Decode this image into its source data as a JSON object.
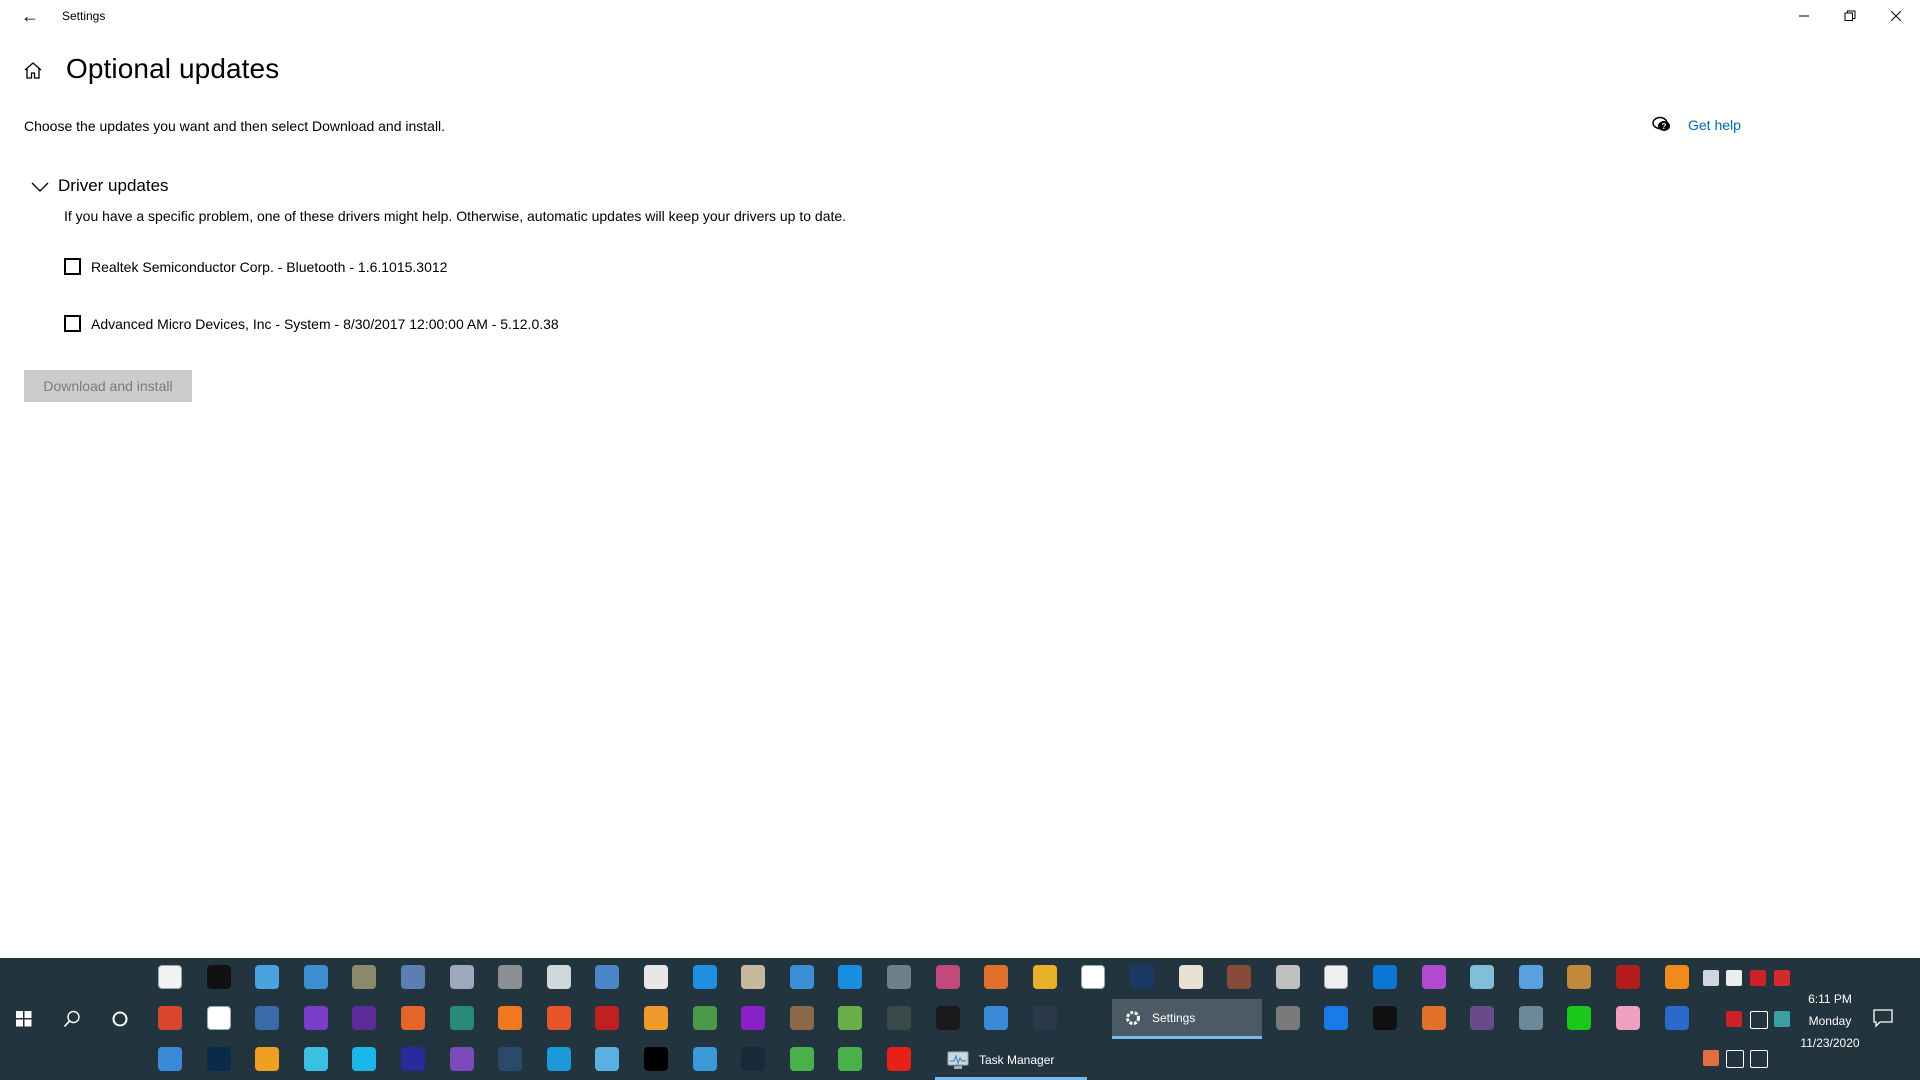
{
  "window": {
    "title": "Settings",
    "back_icon": "back-arrow-icon",
    "controls": {
      "minimize": "minimize-icon",
      "maximize": "restore-icon",
      "close": "close-icon"
    }
  },
  "header": {
    "home_icon": "home-icon",
    "title": "Optional updates",
    "intro": "Choose the updates you want and then select Download and install.",
    "help_label": "Get help",
    "help_icon": "chat-help-icon"
  },
  "section": {
    "title": "Driver updates",
    "expanded": true,
    "description": "If you have a specific problem, one of these drivers might help. Otherwise, automatic updates will keep your drivers up to date.",
    "items": [
      {
        "label": "Realtek Semiconductor Corp. - Bluetooth - 1.6.1015.3012",
        "checked": false
      },
      {
        "label": "Advanced Micro Devices, Inc - System - 8/30/2017 12:00:00 AM - 5.12.0.38",
        "checked": false
      }
    ]
  },
  "actions": {
    "download_label": "Download and install",
    "download_enabled": false
  },
  "taskbar": {
    "start_icon": "windows-start-icon",
    "search_icon": "search-icon",
    "cortana_icon": "cortana-icon",
    "running": [
      {
        "label": "Settings",
        "icon": "settings-gear-icon",
        "active": true
      },
      {
        "label": "Task Manager",
        "icon": "task-manager-icon",
        "active": false
      }
    ],
    "pinned_row1": [
      {
        "name": "microsoft-store-icon",
        "color": "#f2f2f2"
      },
      {
        "name": "command-prompt-icon",
        "color": "#111111"
      },
      {
        "name": "control-panel-icon",
        "color": "#4aa3df"
      },
      {
        "name": "remote-desktop-icon",
        "color": "#3d8fd1"
      },
      {
        "name": "xbox-accessories-icon",
        "color": "#8a8a6a"
      },
      {
        "name": "printer-icon",
        "color": "#5a7fb0"
      },
      {
        "name": "registry-icon",
        "color": "#a0a8c0"
      },
      {
        "name": "security-lock-icon",
        "color": "#8a8f95"
      },
      {
        "name": "services-gear-icon",
        "color": "#cfd6dc"
      },
      {
        "name": "system-info-icon",
        "color": "#4a86c8"
      },
      {
        "name": "clock-icon",
        "color": "#e7e7e7"
      },
      {
        "name": "internet-explorer-icon",
        "color": "#1e90e0"
      },
      {
        "name": "paint-icon",
        "color": "#c8b89a"
      },
      {
        "name": "media-player-icon",
        "color": "#3b8fd6"
      },
      {
        "name": "mail-icon",
        "color": "#1a8ee0"
      },
      {
        "name": "calculator-icon",
        "color": "#6f7f8c"
      },
      {
        "name": "groove-music-icon",
        "color": "#c24a7a"
      },
      {
        "name": "temperature-icon",
        "color": "#e0712a"
      },
      {
        "name": "chrome-icon",
        "color": "#e8b12a"
      },
      {
        "name": "people-icon",
        "color": "#ffffff"
      },
      {
        "name": "steam-icon",
        "color": "#1b3a63"
      },
      {
        "name": "compass-icon",
        "color": "#e8e0d0"
      },
      {
        "name": "firewall-icon",
        "color": "#8a4a3a"
      },
      {
        "name": "memory-icon",
        "color": "#c0c0c0"
      },
      {
        "name": "drive-icon",
        "color": "#f0f0f0"
      },
      {
        "name": "settings-blue-icon",
        "color": "#0b78d6"
      },
      {
        "name": "office-tools-icon",
        "color": "#b24ad0"
      },
      {
        "name": "notepad-icon",
        "color": "#7fc0d8"
      },
      {
        "name": "wordpad-icon",
        "color": "#5aa0e0"
      },
      {
        "name": "disc-burn-icon",
        "color": "#c08a3a"
      },
      {
        "name": "acrobat-icon",
        "color": "#b71c1c"
      },
      {
        "name": "vlc-icon",
        "color": "#f08a1a"
      }
    ],
    "pinned_row2": [
      {
        "name": "power-icon",
        "color": "#d9452f"
      },
      {
        "name": "windows-security-icon",
        "color": "#ffffff"
      },
      {
        "name": "windows7-orb-icon",
        "color": "#3a6aa8"
      },
      {
        "name": "twitch-icon",
        "color": "#7b3ccc"
      },
      {
        "name": "cpu-icon",
        "color": "#5b2c9a"
      },
      {
        "name": "origin-icon",
        "color": "#e8652a"
      },
      {
        "name": "mouse-keyboard-icon",
        "color": "#2a8a7a"
      },
      {
        "name": "asterisk-app-icon",
        "color": "#f07820"
      },
      {
        "name": "firefox-icon",
        "color": "#e8552a"
      },
      {
        "name": "flash-icon",
        "color": "#c02020"
      },
      {
        "name": "orange-app-icon",
        "color": "#f09a2a"
      },
      {
        "name": "network-card-icon",
        "color": "#4a9a4a"
      },
      {
        "name": "purple-ring-icon",
        "color": "#8a20c8"
      },
      {
        "name": "game-warrior-icon",
        "color": "#8a6a4a"
      },
      {
        "name": "game-pixel-icon",
        "color": "#6ab04a"
      },
      {
        "name": "shield-swords-icon",
        "color": "#3a4a4a"
      },
      {
        "name": "bold-b-icon",
        "color": "#1a1a1a"
      },
      {
        "name": "computer-icon",
        "color": "#3a8ad8"
      },
      {
        "name": "hex-compass-icon",
        "color": "#2a3a4a"
      },
      {
        "name": "rockets-icon",
        "color": "#5a6aa8"
      },
      {
        "name": "server-icon",
        "color": "#7a7a7a"
      },
      {
        "name": "uplay-icon",
        "color": "#1a7ae8"
      },
      {
        "name": "epic-games-icon",
        "color": "#111111"
      },
      {
        "name": "disc-flame-icon",
        "color": "#e0702a"
      },
      {
        "name": "film-reel-icon",
        "color": "#6a4a8a"
      },
      {
        "name": "dvd-icon",
        "color": "#6a8a9a"
      },
      {
        "name": "video-editor-icon",
        "color": "#1ac81a"
      },
      {
        "name": "photos-flower-icon",
        "color": "#f0a0c0"
      },
      {
        "name": "blue-disc-icon",
        "color": "#2a6ac8"
      }
    ],
    "pinned_row3": [
      {
        "name": "dvd-maker-icon",
        "color": "#3a8ad8"
      },
      {
        "name": "blue-star-icon",
        "color": "#0a2a4a"
      },
      {
        "name": "weather-icon",
        "color": "#f0a020"
      },
      {
        "name": "alexa-disc-icon",
        "color": "#3ac0e0"
      },
      {
        "name": "alexa-icon",
        "color": "#1ab8e8"
      },
      {
        "name": "amazon-music-icon",
        "color": "#2a2a9a"
      },
      {
        "name": "media-d-icon",
        "color": "#7a4ab8"
      },
      {
        "name": "equalizer-icon",
        "color": "#2a4a6a"
      },
      {
        "name": "edge-icon",
        "color": "#1a9ad8"
      },
      {
        "name": "backup-icon",
        "color": "#5ab0e0"
      },
      {
        "name": "k-app-icon",
        "color": "#000000"
      },
      {
        "name": "wand-icon",
        "color": "#3a9ad8"
      },
      {
        "name": "checkmark-app-icon",
        "color": "#1a2a3a"
      },
      {
        "name": "gears-green-icon",
        "color": "#4ab04a"
      },
      {
        "name": "gears-green-2-icon",
        "color": "#4ab04a"
      },
      {
        "name": "youtube-music-icon",
        "color": "#e8201a"
      }
    ],
    "tray": {
      "row1": [
        "show-desktop-grid-icon",
        "corsair-icon",
        "red-network-icon",
        "red-link-icon"
      ],
      "row2": [
        "bitdefender-icon",
        "defender-shield-icon",
        "keyboard-mouse-icon"
      ],
      "row3": [
        "speaker-muted-icon",
        "network-icon",
        "volume-icon"
      ]
    },
    "clock": {
      "time": "6:11 PM",
      "day": "Monday",
      "date": "11/23/2020"
    },
    "notification_icon": "action-center-icon"
  }
}
